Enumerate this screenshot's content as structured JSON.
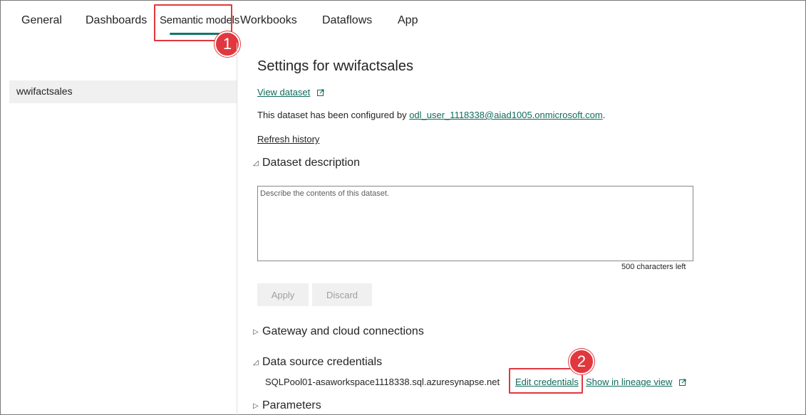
{
  "tabs": [
    {
      "label": "General"
    },
    {
      "label": "Dashboards"
    },
    {
      "label": "Semantic models"
    },
    {
      "label": "Workbooks"
    },
    {
      "label": "Dataflows"
    },
    {
      "label": "App"
    }
  ],
  "callouts": {
    "one": "1",
    "two": "2"
  },
  "left_pane": {
    "items": [
      {
        "label": "wwifactsales"
      }
    ]
  },
  "main": {
    "title": "Settings for wwifactsales",
    "view_dataset": "View dataset",
    "configured_prefix": "This dataset has been configured by ",
    "configured_user": "odl_user_1118338@aiad1005.onmicrosoft.com",
    "configured_suffix": ".",
    "refresh_history": "Refresh history",
    "dataset_description_heading": "Dataset description",
    "description_placeholder": "Describe the contents of this dataset.",
    "chars_left": "500 characters left",
    "apply_label": "Apply",
    "discard_label": "Discard",
    "gateway_heading": "Gateway and cloud connections",
    "credentials_heading": "Data source credentials",
    "source_name": "SQLPool01-asaworkspace1118338.sql.azuresynapse.net",
    "edit_credentials": "Edit credentials",
    "lineage_view": "Show in lineage view",
    "parameters_heading": "Parameters"
  },
  "colors": {
    "accent": "#117865",
    "callout": "#e0383e",
    "link": "#0f6b5c"
  },
  "icons": [
    "external-link-icon",
    "collapse-triangle-icon",
    "expand-triangle-icon"
  ]
}
